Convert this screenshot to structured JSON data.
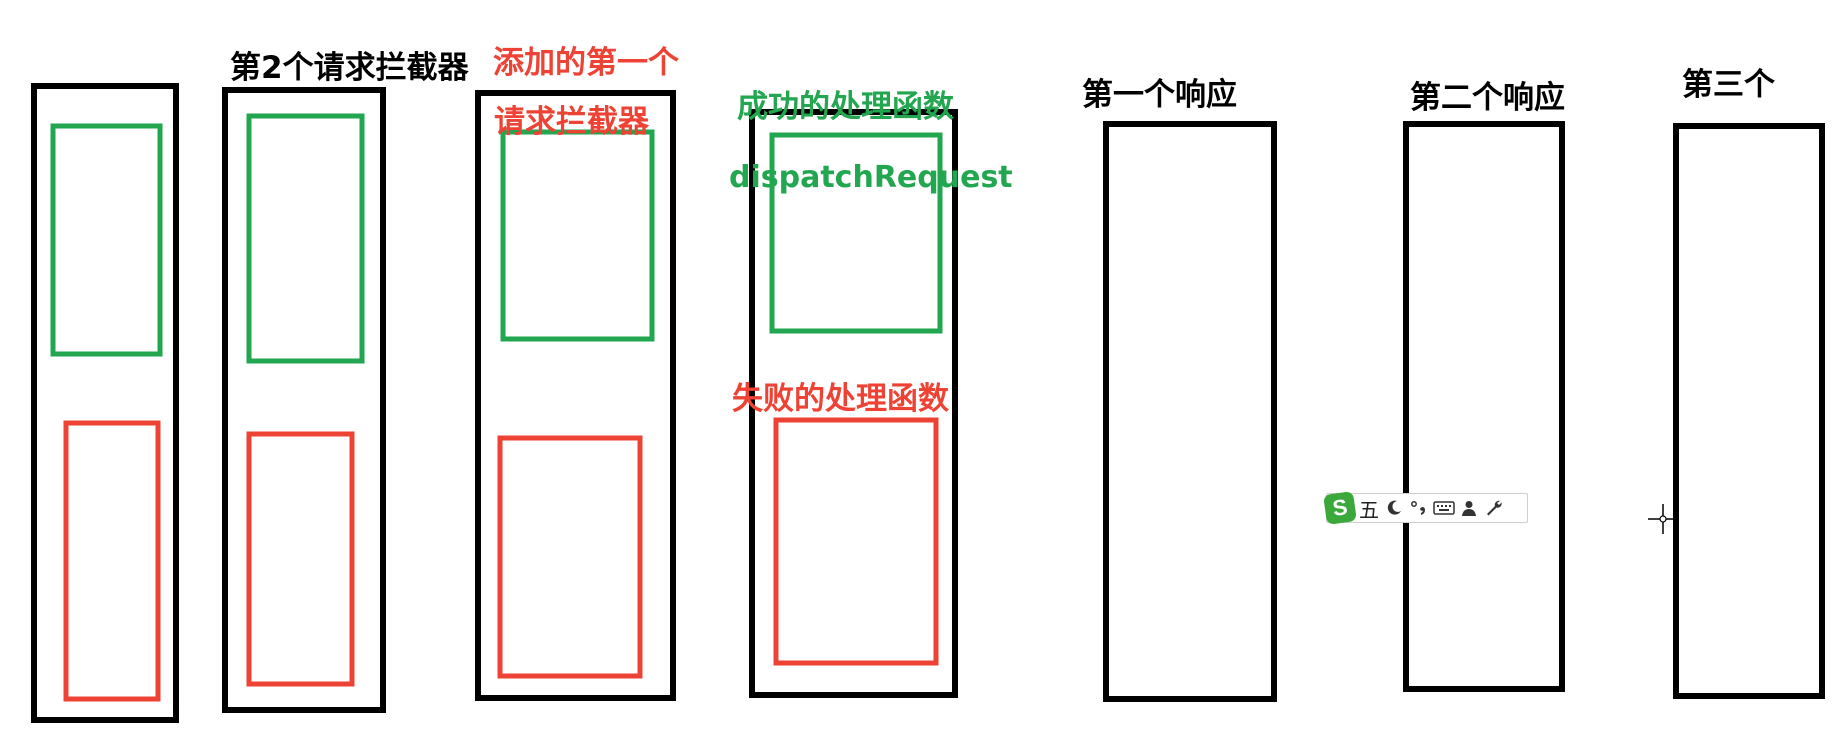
{
  "labels": {
    "second_interceptor": "第2个请求拦截器",
    "first_added_line1": "添加的第一个",
    "first_added_line2": "请求拦截器",
    "success_handler": "成功的处理函数",
    "dispatch_request": "dispatchRequest",
    "failure_handler": "失败的处理函数",
    "first_response": "第一个响应",
    "second_response": "第二个响应",
    "third": "第三个"
  },
  "ime_toolbar": {
    "logo": "S",
    "mode": "五",
    "icons": [
      "moon-icon",
      "punctuation-icon",
      "keyboard-icon",
      "user-icon",
      "wrench-icon"
    ]
  },
  "colors": {
    "outline": "#000000",
    "success": "#22a650",
    "failure": "#ee4234"
  }
}
